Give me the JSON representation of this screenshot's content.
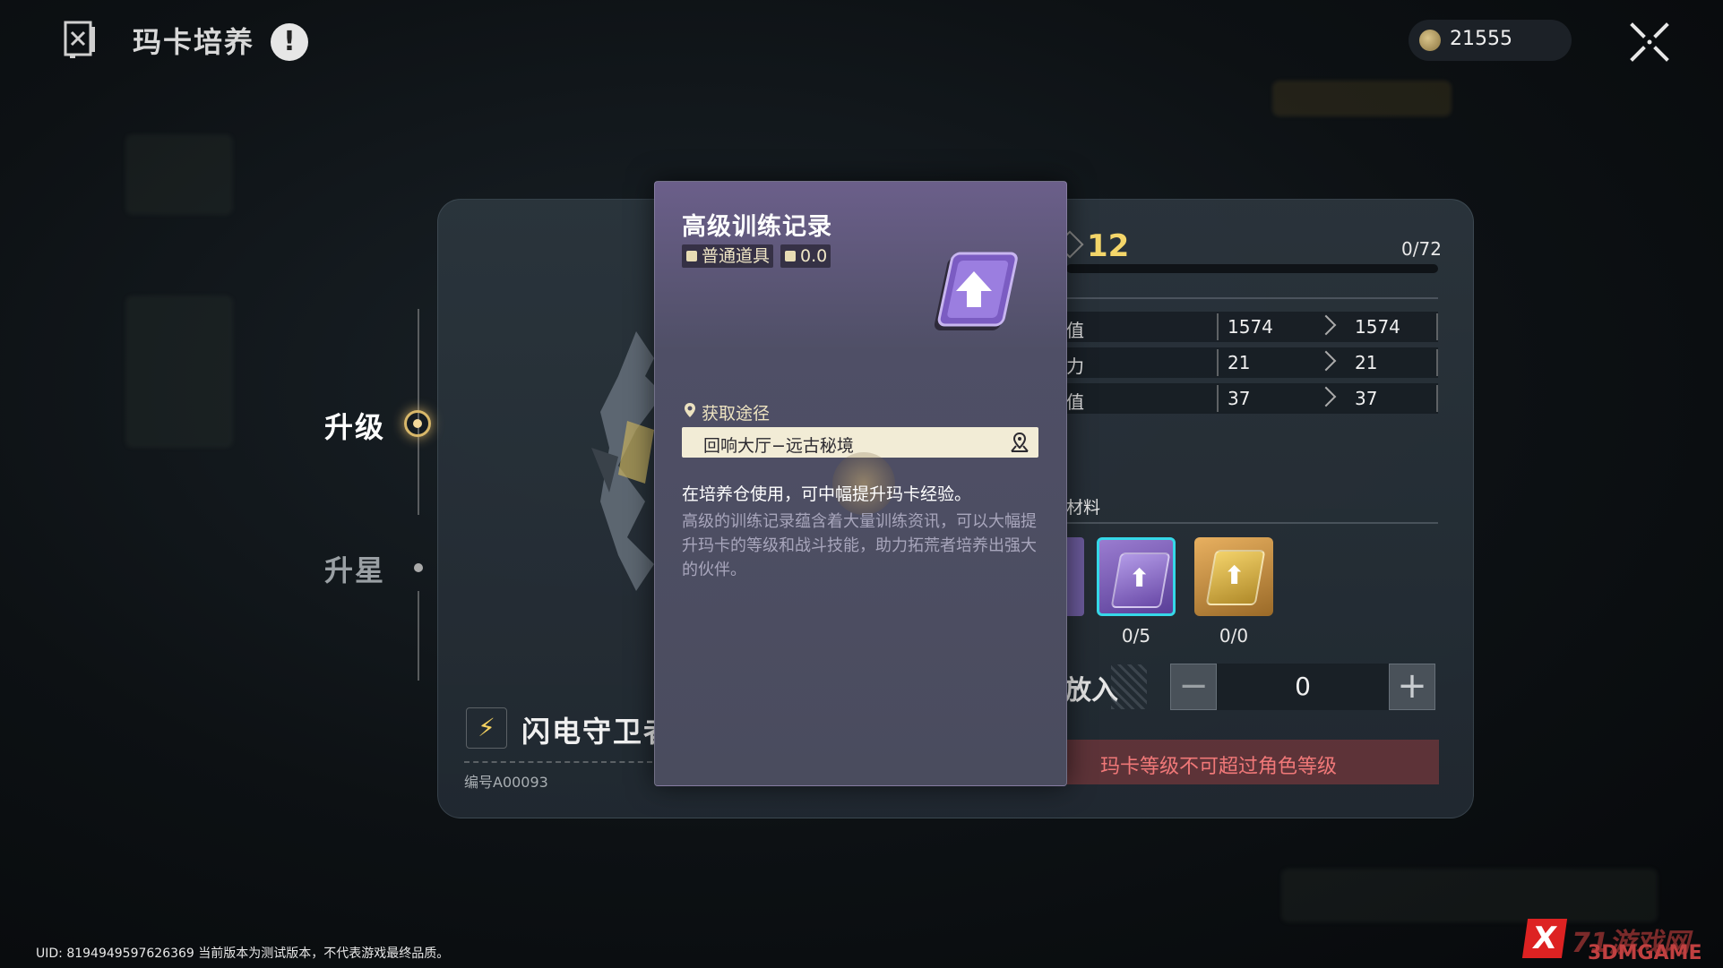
{
  "header": {
    "title": "玛卡培养",
    "alert_glyph": "!",
    "currency_value": "21555"
  },
  "nav": {
    "upgrade_label": "升级",
    "star_label": "升星"
  },
  "creature": {
    "name": "闪电守卫者",
    "serial": "编号A00093"
  },
  "level": {
    "value": "12",
    "exp_text": "0/72"
  },
  "stats": [
    {
      "label": "值",
      "current": "1574",
      "next": "1574"
    },
    {
      "label": "力",
      "current": "21",
      "next": "21"
    },
    {
      "label": "值",
      "current": "37",
      "next": "37"
    }
  ],
  "materials": {
    "label": "材料",
    "items": [
      {
        "count": "0/5",
        "color": "#7a5cb8"
      },
      {
        "count": "0/0",
        "color": "#d8a04a"
      }
    ]
  },
  "put_in": {
    "label": "放入",
    "minus": "−",
    "value": "0",
    "plus": "+"
  },
  "warning": "玛卡等级不可超过角色等级",
  "tooltip": {
    "title": "高级训练记录",
    "type_tag": "普通道具",
    "weight_tag": "0.0",
    "obtain_label": "获取途径",
    "obtain_source": "回响大厅−远古秘境",
    "desc_main": "在培养仓使用，可中幅提升玛卡经验。",
    "desc_sub": "高级的训练记录蕴含着大量训练资讯，可以大幅提升玛卡的等级和战斗技能，助力拓荒者培养出强大的伙伴。"
  },
  "footer": {
    "uid": "UID: 8194949597626369 当前版本为测试版本，不代表游戏最终品质。"
  },
  "watermark": {
    "logo": "X",
    "text": "71游戏网",
    "sub": "3DMGAME"
  },
  "colors": {
    "accent_gold": "#f4d66a",
    "warning_red": "#f07878",
    "card_purple": "#6b5f8a",
    "selected_cyan": "#36d8e8"
  }
}
